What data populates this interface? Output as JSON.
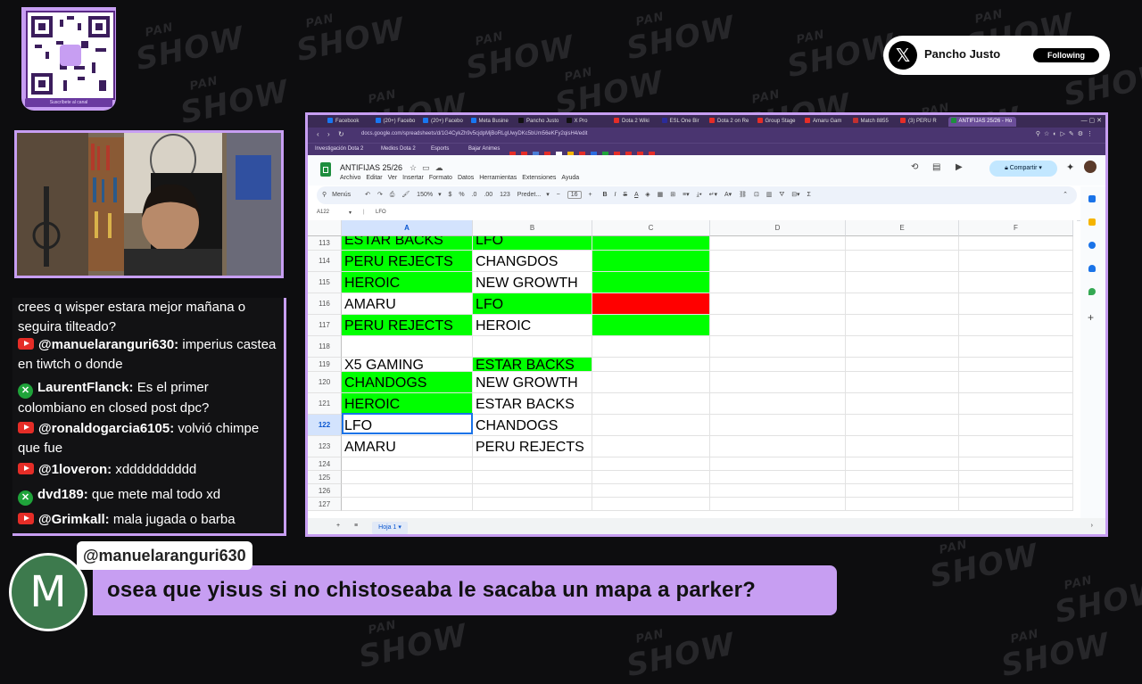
{
  "watermark": {
    "brand_top": "PAN",
    "brand_main": "SHOW"
  },
  "qr": {
    "caption": "Suscríbete al canal"
  },
  "follow_card": {
    "name": "Pancho Justo",
    "button": "Following"
  },
  "chat": {
    "messages": [
      {
        "platform": "",
        "user": "",
        "text": "crees q wisper estara mejor mañana o seguira tilteado?"
      },
      {
        "platform": "youtube",
        "user": "@manuelaranguri630:",
        "text": "imperius castea en tiwtch o donde"
      },
      {
        "platform": "xbox",
        "user": "LaurentFlanck:",
        "text": "Es el primer colombiano en closed post dpc?"
      },
      {
        "platform": "youtube",
        "user": "@ronaldogarcia6105:",
        "text": "volvió chimpe que fue"
      },
      {
        "platform": "youtube",
        "user": "@1loveron:",
        "text": "xdddddddddd"
      },
      {
        "platform": "xbox",
        "user": "dvd189:",
        "text": "que mete mal todo xd"
      },
      {
        "platform": "youtube",
        "user": "@Grimkall:",
        "text": "mala jugada o barba"
      }
    ]
  },
  "browser": {
    "tabs": [
      "Facebook",
      "(20+) Facebo",
      "(20+) Facebo",
      "Meta Busine",
      "Pancho Justo",
      "X Pro",
      "Dota 2 Wiki",
      "ESL One Bir",
      "Dota 2 on Re",
      "Group Stage",
      "Amaru Gam",
      "Match 8855",
      "(3) PERU R",
      "ANTIFIJAS 25/26 - Ho"
    ],
    "url": "docs.google.com/spreadsheets/d/1G4CykZh9v5cjdpMjBoRLgUwyDKc5bUm56eKFy2qisH4/edit",
    "bookmarks": [
      "Investigación Dota 2",
      "Medios Dota 2",
      "Esports",
      "Bajar Animes"
    ],
    "window_controls": "—  ▢  ✕"
  },
  "sheet": {
    "title": "ANTIFIJAS 25/26",
    "menu": [
      "Archivo",
      "Editar",
      "Ver",
      "Insertar",
      "Formato",
      "Datos",
      "Herramientas",
      "Extensiones",
      "Ayuda"
    ],
    "share_label": "Compartir",
    "toolbar": {
      "menus": "Menús",
      "zoom": "150%",
      "font": "Predet...",
      "size": "16",
      "currency": "$",
      "percent": "%",
      "dec": ".0",
      "dec2": ".00",
      "num": "123"
    },
    "name_box": "A122",
    "formula": "LFO",
    "columns": [
      "A",
      "B",
      "C",
      "D",
      "E",
      "F"
    ],
    "rows": [
      {
        "n": "113",
        "a": "ESTAR BACKS",
        "af": "g",
        "b": "LFO",
        "bf": "g",
        "cf": "g"
      },
      {
        "n": "114",
        "a": "PERU REJECTS",
        "af": "g",
        "b": "CHANGDOS",
        "bf": "",
        "cf": "g"
      },
      {
        "n": "115",
        "a": "HEROIC",
        "af": "g",
        "b": "NEW GROWTH",
        "bf": "",
        "cf": "g"
      },
      {
        "n": "116",
        "a": "AMARU",
        "af": "",
        "b": "LFO",
        "bf": "g",
        "cf": "r"
      },
      {
        "n": "117",
        "a": "PERU REJECTS",
        "af": "g",
        "b": "HEROIC",
        "bf": "",
        "cf": "g"
      },
      {
        "n": "118",
        "a": "",
        "af": "",
        "b": "",
        "bf": "",
        "cf": ""
      },
      {
        "n": "119",
        "a": "X5 GAMING",
        "af": "",
        "b": "ESTAR BACKS",
        "bf": "g",
        "cf": ""
      },
      {
        "n": "120",
        "a": "CHANDOGS",
        "af": "g",
        "b": "NEW GROWTH",
        "bf": "",
        "cf": ""
      },
      {
        "n": "121",
        "a": "HEROIC",
        "af": "g",
        "b": "ESTAR BACKS",
        "bf": "",
        "cf": ""
      },
      {
        "n": "122",
        "a": "LFO",
        "af": "",
        "b": "CHANDOGS",
        "bf": "",
        "cf": ""
      },
      {
        "n": "123",
        "a": "AMARU",
        "af": "",
        "b": "PERU REJECTS",
        "bf": "",
        "cf": ""
      },
      {
        "n": "124",
        "a": "",
        "af": "",
        "b": "",
        "bf": "",
        "cf": ""
      },
      {
        "n": "125",
        "a": "",
        "af": "",
        "b": "",
        "bf": "",
        "cf": ""
      },
      {
        "n": "126",
        "a": "",
        "af": "",
        "b": "",
        "bf": "",
        "cf": ""
      },
      {
        "n": "127",
        "a": "",
        "af": "",
        "b": "",
        "bf": "",
        "cf": ""
      }
    ],
    "sheet_tab": "Hoja 1"
  },
  "overlay": {
    "avatar_letter": "M",
    "user": "@manuelaranguri630",
    "message": "osea que yisus si no chistoseaba le sacaba un mapa a parker?"
  },
  "colors": {
    "accent_purple": "#c79ef2",
    "green_fill": "#00ff00",
    "red_fill": "#ff0000",
    "youtube_red": "#e52d27",
    "xbox_green": "#1fa33a"
  }
}
